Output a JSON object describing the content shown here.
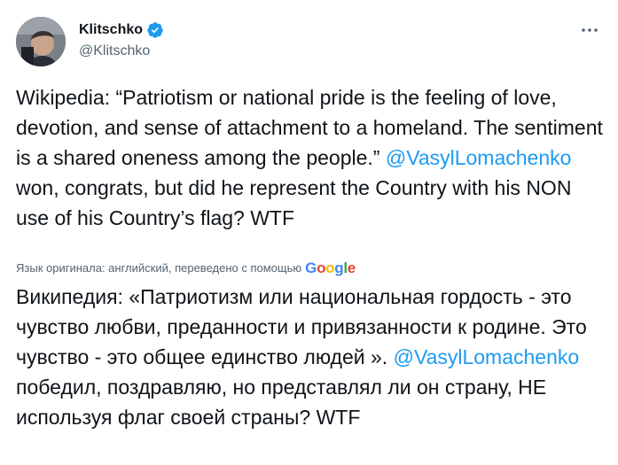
{
  "author": {
    "display_name": "Klitschko",
    "handle": "@Klitschko"
  },
  "tweet": {
    "text_before_mention": "Wikipedia: “Patriotism or national pride is the feeling of love, devotion, and sense of attachment to a homeland. The sentiment is a shared oneness among the people.” ",
    "mention": "@VasylLomachenko",
    "text_after_mention": " won, congrats, but did he represent the Country with his NON use of his Country’s flag? WTF"
  },
  "translation": {
    "note": "Язык оригинала: английский, переведено с помощью",
    "provider_letters": [
      "G",
      "o",
      "o",
      "g",
      "l",
      "e"
    ],
    "text_before_mention": "Википедия: «Патриотизм или национальная гордость - это чувство любви, преданности и привязанности к родине. Это чувство - это общее единство людей ». ",
    "mention": "@VasylLomachenko",
    "text_after_mention": " победил, поздравляю, но представлял ли он страну, НЕ используя флаг своей страны? WTF"
  },
  "icons": {
    "verified": "verified-badge-icon",
    "more": "more-options-icon"
  },
  "colors": {
    "link": "#1d9bf0",
    "text": "#0f1419",
    "secondary": "#536471"
  }
}
